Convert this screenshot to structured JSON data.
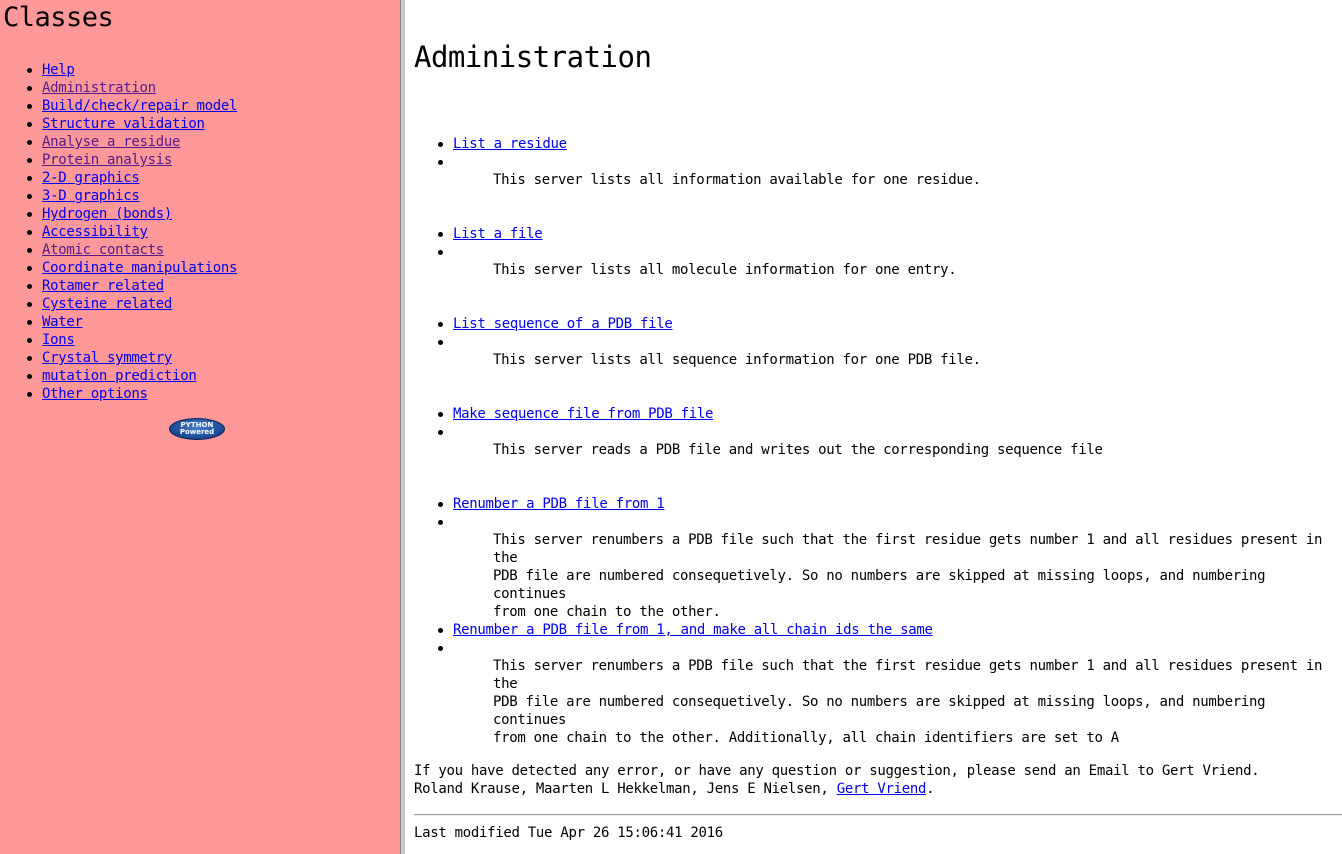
{
  "sidebar": {
    "title": "Classes",
    "items": [
      {
        "label": "Help",
        "visited": false
      },
      {
        "label": "Administration",
        "visited": true
      },
      {
        "label": "Build/check/repair model",
        "visited": false
      },
      {
        "label": "Structure validation",
        "visited": false
      },
      {
        "label": "Analyse a residue",
        "visited": true
      },
      {
        "label": "Protein analysis",
        "visited": true
      },
      {
        "label": "2-D graphics",
        "visited": false
      },
      {
        "label": "3-D graphics",
        "visited": false
      },
      {
        "label": "Hydrogen (bonds)",
        "visited": false
      },
      {
        "label": "Accessibility",
        "visited": false
      },
      {
        "label": "Atomic contacts",
        "visited": true
      },
      {
        "label": "Coordinate manipulations",
        "visited": false
      },
      {
        "label": "Rotamer related",
        "visited": false
      },
      {
        "label": "Cysteine related",
        "visited": false
      },
      {
        "label": "Water",
        "visited": false
      },
      {
        "label": "Ions",
        "visited": false
      },
      {
        "label": "Crystal symmetry",
        "visited": false
      },
      {
        "label": "mutation prediction",
        "visited": false
      },
      {
        "label": "Other options",
        "visited": false
      }
    ],
    "badge": {
      "line1": "PYTHON",
      "line2": "Powered",
      "icon": "python-powered-logo"
    }
  },
  "main": {
    "title": "Administration",
    "entries": [
      {
        "link": "List a residue",
        "description": "This server lists all information available for one residue."
      },
      {
        "link": "List a file",
        "description": "This server lists all molecule information for one entry."
      },
      {
        "link": "List sequence of a PDB file",
        "description": "This server lists all sequence information for one PDB file."
      },
      {
        "link": "Make sequence file from PDB file",
        "description": "This server reads a PDB file and writes out the corresponding sequence file"
      },
      {
        "link": "Renumber a PDB file from 1",
        "description": "This server renumbers a PDB file such that the first residue gets number 1 and all residues present in the\nPDB file are numbered consequetively. So no numbers are skipped at missing loops, and numbering continues\nfrom one chain to the other."
      },
      {
        "link": "Renumber a PDB file from 1, and make all chain ids the same",
        "description": "This server renumbers a PDB file such that the first residue gets number 1 and all residues present in the\nPDB file are numbered consequetively. So no numbers are skipped at missing loops, and numbering continues\nfrom one chain to the other. Additionally, all chain identifiers are set to A"
      }
    ],
    "footer": {
      "line1": "If you have detected any error, or have any question or suggestion, please send an Email to Gert Vriend.",
      "authors_prefix": "Roland Krause, Maarten L Hekkelman, Jens E Nielsen, ",
      "author_link": "Gert Vriend",
      "authors_suffix": "."
    },
    "last_modified": "Last modified Tue Apr 26 15:06:41 2016"
  },
  "colors": {
    "sidebar_bg": "#ff9999",
    "link": "#0000ee",
    "visited_link": "#551a8b"
  }
}
